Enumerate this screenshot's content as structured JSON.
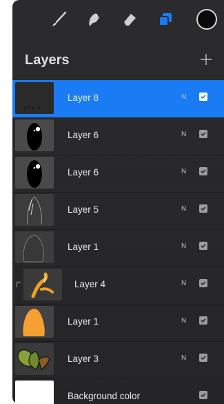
{
  "toolbar": {
    "tools": [
      "brush-icon",
      "smudge-icon",
      "eraser-icon",
      "layers-icon",
      "color-icon"
    ],
    "accent": "#1a7cf5"
  },
  "header": {
    "title": "Layers"
  },
  "layers": [
    {
      "name": "Layer 8",
      "blend": "N",
      "selected": true
    },
    {
      "name": "Layer 6",
      "blend": "N",
      "selected": false
    },
    {
      "name": "Layer 6",
      "blend": "N",
      "selected": false
    },
    {
      "name": "Layer 5",
      "blend": "N",
      "selected": false
    },
    {
      "name": "Layer 1",
      "blend": "N",
      "selected": false
    },
    {
      "name": "Layer 4",
      "blend": "N",
      "selected": false,
      "clipped": true
    },
    {
      "name": "Layer 1",
      "blend": "N",
      "selected": false
    },
    {
      "name": "Layer 3",
      "blend": "N",
      "selected": false
    },
    {
      "name": "Background color",
      "blend": "",
      "selected": false
    }
  ]
}
